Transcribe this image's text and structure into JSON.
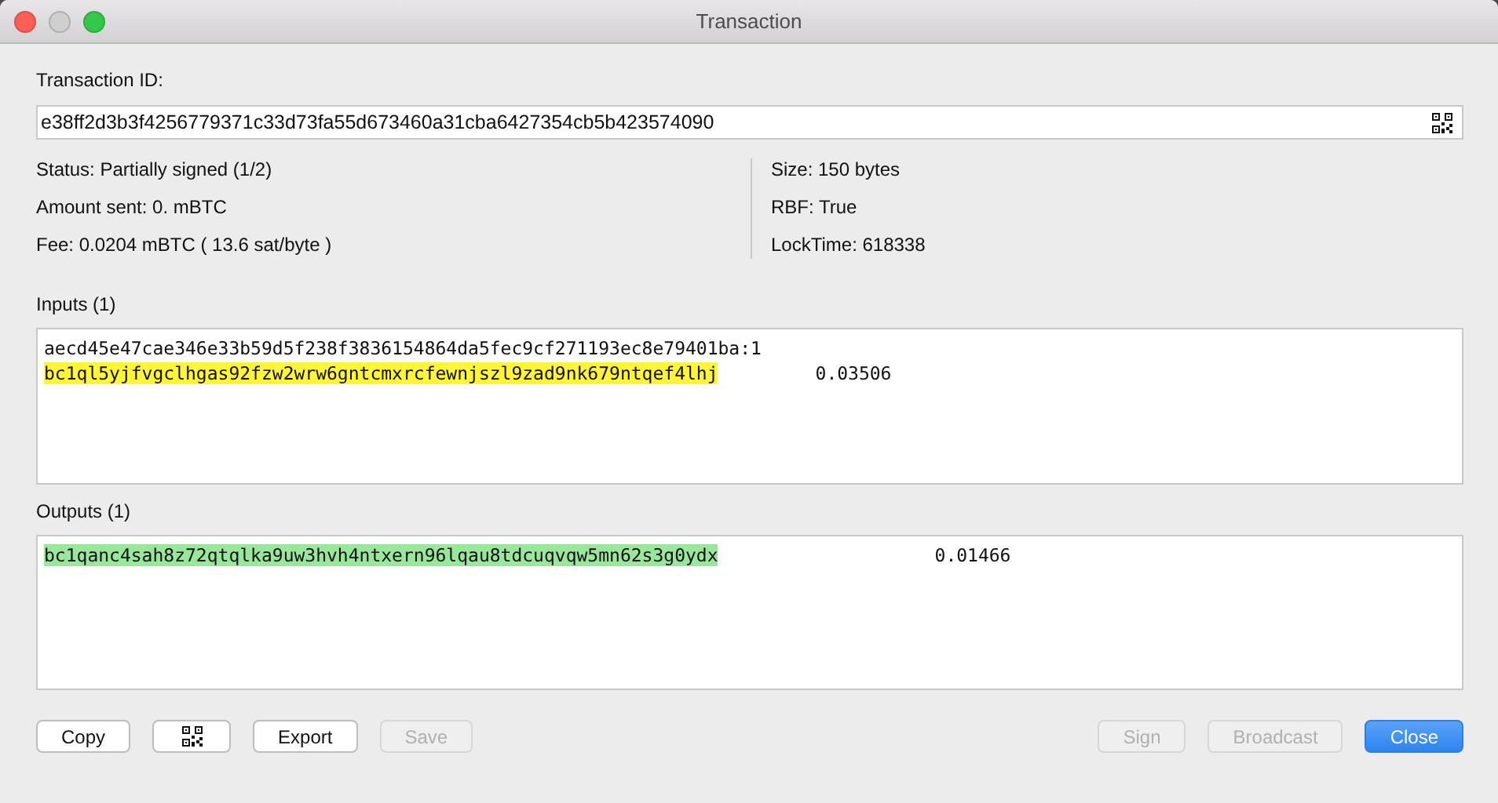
{
  "window": {
    "title": "Transaction"
  },
  "txid": {
    "label": "Transaction ID:",
    "value": "e38ff2d3b3f4256779371c33d73fa55d673460a31cba6427354cb5b423574090"
  },
  "info_left": [
    "Status: Partially signed (1/2)",
    "Amount sent: 0. mBTC",
    "Fee: 0.0204 mBTC  ( 13.6 sat/byte )"
  ],
  "info_right": [
    "Size: 150 bytes",
    "RBF: True",
    "LockTime: 618338"
  ],
  "inputs": {
    "label": "Inputs (1)",
    "items": [
      {
        "outpoint": "aecd45e47cae346e33b59d5f238f3836154864da5fec9cf271193ec8e79401ba:1",
        "address": "bc1ql5yjfvgclhgas92fzw2wrw6gntcmxrcfewnjszl9zad9nk679ntqef4lhj",
        "amount": "0.03506",
        "color": "#fff536"
      }
    ]
  },
  "outputs": {
    "label": "Outputs (1)",
    "items": [
      {
        "address": "bc1qanc4sah8z72qtqlka9uw3hvh4ntxern96lqau8tdcuqvqw5mn62s3g0ydx",
        "amount": "0.01466",
        "color": "#99e79b"
      }
    ]
  },
  "buttons_left": [
    {
      "kind": "text",
      "label": "Copy",
      "disabled": false,
      "primary": false
    },
    {
      "kind": "qr",
      "disabled": false,
      "primary": false
    },
    {
      "kind": "text",
      "label": "Export",
      "disabled": false,
      "primary": false
    },
    {
      "kind": "text",
      "label": "Save",
      "disabled": true,
      "primary": false
    }
  ],
  "buttons_right": [
    {
      "kind": "text",
      "label": "Sign",
      "disabled": true,
      "primary": false
    },
    {
      "kind": "text",
      "label": "Broadcast",
      "disabled": true,
      "primary": false
    },
    {
      "kind": "text",
      "label": "Close",
      "disabled": false,
      "primary": true
    }
  ]
}
